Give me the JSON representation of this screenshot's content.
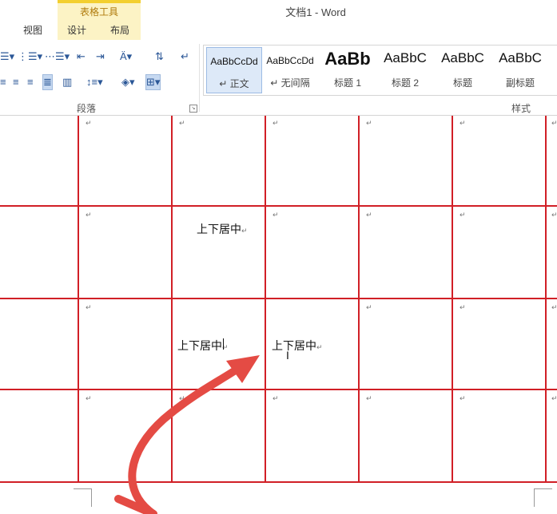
{
  "window": {
    "title": "文档1 - Word"
  },
  "context_group": {
    "title": "表格工具",
    "tabs": [
      "设计",
      "布局"
    ]
  },
  "tabs": {
    "view": "视图"
  },
  "ribbon": {
    "paragraph_label": "段落",
    "styles_label": "样式",
    "styles": [
      {
        "preview": "AaBbCcDd",
        "name": "↵ 正文"
      },
      {
        "preview": "AaBbCcDd",
        "name": "↵ 无间隔"
      },
      {
        "preview": "AaBb",
        "name": "标题 1"
      },
      {
        "preview": "AaBbC",
        "name": "标题 2"
      },
      {
        "preview": "AaBbC",
        "name": "标题"
      },
      {
        "preview": "AaBbC",
        "name": "副标题"
      }
    ]
  },
  "document": {
    "cells": {
      "r2c3": "上下居中",
      "r3c3": "上下居中",
      "r3c4": "上下居中"
    },
    "paragraph_mark": "↵"
  },
  "colors": {
    "table_border": "#d11f26",
    "arrow": "#e44b44",
    "context_tab": "#fcf3c5"
  }
}
